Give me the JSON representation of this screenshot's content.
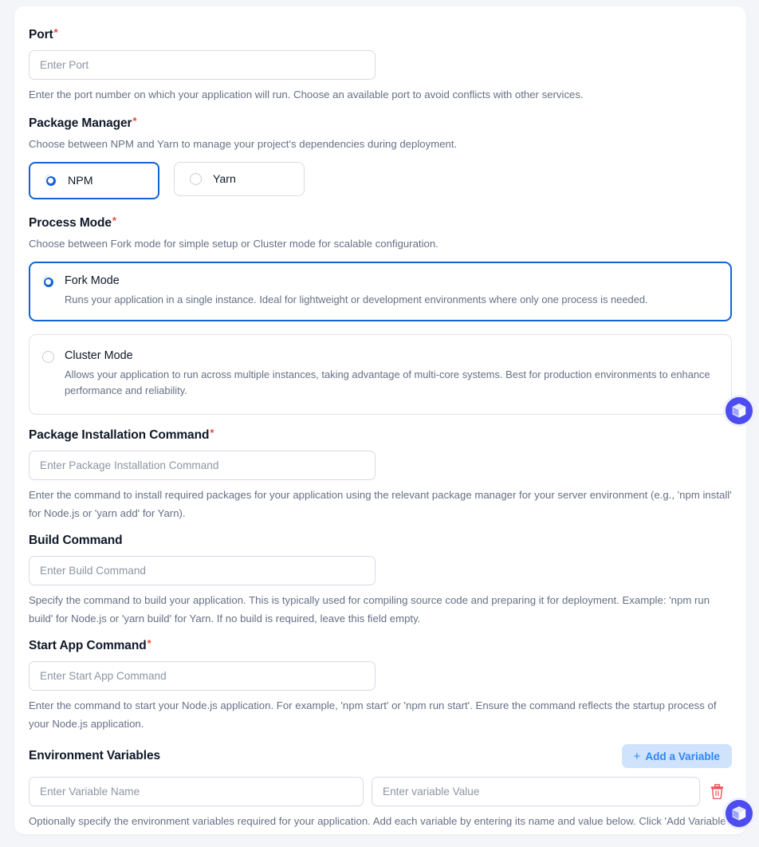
{
  "form": {
    "port": {
      "label": "Port",
      "required": true,
      "placeholder": "Enter Port",
      "value": "",
      "helper": "Enter the port number on which your application will run. Choose an available port to avoid conflicts with other services."
    },
    "package_manager": {
      "label": "Package Manager",
      "required": true,
      "helper": "Choose between NPM and Yarn to manage your project's dependencies during deployment.",
      "selected": "NPM",
      "options": [
        {
          "label": "NPM",
          "selected": true
        },
        {
          "label": "Yarn",
          "selected": false
        }
      ]
    },
    "process_mode": {
      "label": "Process Mode",
      "required": true,
      "helper": "Choose between Fork mode for simple setup or Cluster mode for scalable configuration.",
      "selected": "Fork Mode",
      "options": [
        {
          "title": "Fork Mode",
          "description": "Runs your application in a single instance. Ideal for lightweight or development environments where only one process is needed.",
          "selected": true
        },
        {
          "title": "Cluster Mode",
          "description": "Allows your application to run across multiple instances, taking advantage of multi-core systems. Best for production environments to enhance performance and reliability.",
          "selected": false
        }
      ]
    },
    "package_installation_command": {
      "label": "Package Installation Command",
      "required": true,
      "placeholder": "Enter Package Installation Command",
      "value": "",
      "helper": "Enter the command to install required packages for your application using the relevant package manager for your server environment (e.g., 'npm install' for Node.js or 'yarn add' for Yarn)."
    },
    "build_command": {
      "label": "Build Command",
      "required": false,
      "placeholder": "Enter Build Command",
      "value": "",
      "helper": "Specify the command to build your application. This is typically used for compiling source code and preparing it for deployment. Example: 'npm run build' for Node.js or 'yarn build' for Yarn. If no build is required, leave this field empty."
    },
    "start_app_command": {
      "label": "Start App Command",
      "required": true,
      "placeholder": "Enter Start App Command",
      "value": "",
      "helper": "Enter the command to start your Node.js application. For example, 'npm start' or 'npm run start'. Ensure the command reflects the startup process of your Node.js application."
    },
    "environment_variables": {
      "label": "Environment Variables",
      "add_button_label": "Add a Variable",
      "add_button_icon": "plus-icon",
      "rows": [
        {
          "name_placeholder": "Enter Variable Name",
          "name_value": "",
          "value_placeholder": "Enter variable Value",
          "value_value": "",
          "delete_icon": "trash-icon"
        }
      ],
      "helper": "Optionally specify the environment variables required for your application. Add each variable by entering its name and value below. Click 'Add Variable' to include multiple variables. These variables are essential configuration settings for your app, but it's not mandatory to fill this section."
    }
  },
  "floating_buttons": [
    {
      "icon": "cube-icon",
      "name": "assistant-cube-button-top"
    },
    {
      "icon": "cube-icon",
      "name": "assistant-cube-button-bottom"
    }
  ],
  "symbols": {
    "required_marker": "*",
    "plus": "+"
  },
  "colors": {
    "accent_blue": "#1263d6",
    "add_button_bg": "#cfe3fd",
    "add_button_text": "#2f86f6",
    "required_red": "#f04438",
    "trash_red": "#f2545b",
    "fab_purple": "#4c4cf0",
    "page_bg": "#f4f5f9",
    "border": "#d6dbe3",
    "helper_text": "#667085",
    "heading_text": "#101828"
  }
}
